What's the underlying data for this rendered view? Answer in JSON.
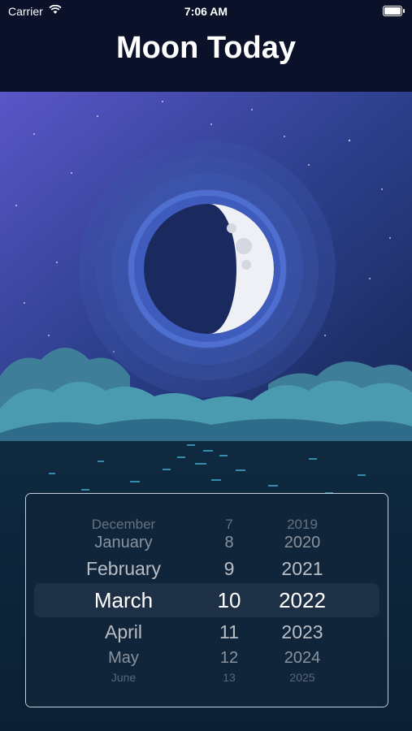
{
  "status_bar": {
    "carrier": "Carrier",
    "time": "7:06 AM"
  },
  "header": {
    "title": "Moon Today"
  },
  "moon": {
    "phase_icon": "waxing-moon-icon"
  },
  "picker": {
    "months": [
      "December",
      "January",
      "February",
      "March",
      "April",
      "May",
      "June"
    ],
    "days": [
      "7",
      "8",
      "9",
      "10",
      "11",
      "12",
      "13"
    ],
    "years": [
      "2019",
      "2020",
      "2021",
      "2022",
      "2023",
      "2024",
      "2025"
    ],
    "selected": {
      "month": "March",
      "day": "10",
      "year": "2022"
    }
  },
  "colors": {
    "header_bg": "#0a1128",
    "sky_top": "#5a56c8",
    "sky_bottom": "#1a2b5a",
    "moon_lit": "#eef0f5",
    "moon_dark": "#1a2a5e",
    "clouds": "#3f8aa0",
    "water": "#0f2a40"
  }
}
